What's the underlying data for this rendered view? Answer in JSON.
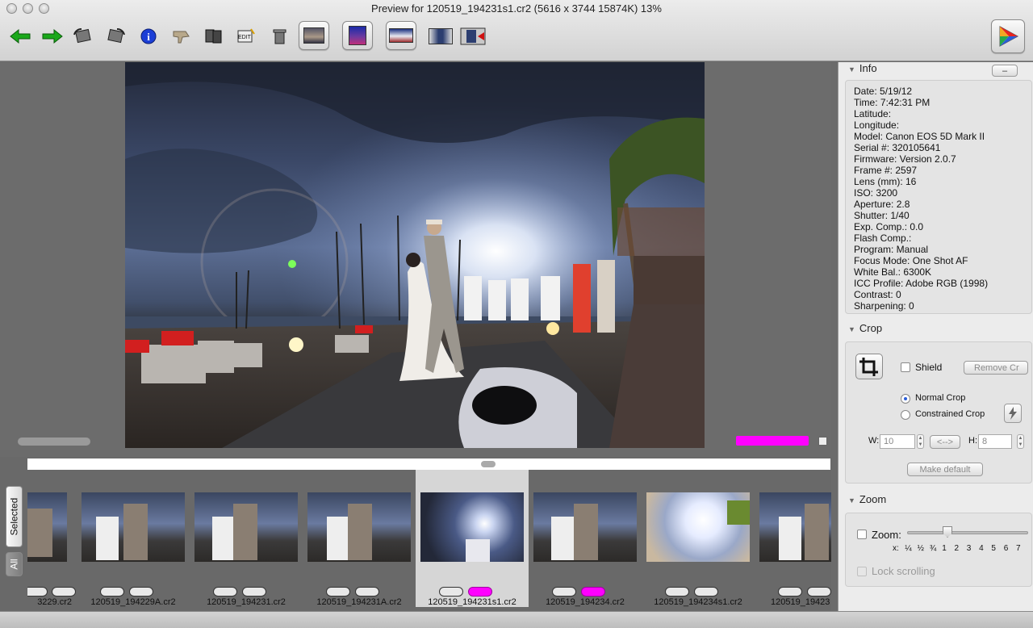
{
  "window": {
    "title": "Preview for 120519_194231s1.cr2 (5616 x 3744 15874K) 13%"
  },
  "toolbar": {
    "buttons": [
      {
        "name": "back-arrow-icon"
      },
      {
        "name": "forward-arrow-icon"
      },
      {
        "name": "rotate-left-icon"
      },
      {
        "name": "rotate-right-icon"
      },
      {
        "name": "info-icon"
      },
      {
        "name": "thumbs-down-icon"
      },
      {
        "name": "cards-icon"
      },
      {
        "name": "edit-text-icon"
      },
      {
        "name": "trash-icon"
      }
    ],
    "view_buttons": [
      {
        "name": "light-table-view-icon"
      },
      {
        "name": "preview-view-icon"
      },
      {
        "name": "filmstrip-view-icon"
      },
      {
        "name": "single-view-icon"
      },
      {
        "name": "send-view-icon"
      }
    ],
    "color_icon": "color-wheel-icon"
  },
  "filmstrip": {
    "tabs": {
      "selected": "Selected",
      "all": "All"
    },
    "items": [
      {
        "file": "3229.cr2",
        "rated": false,
        "selected": false
      },
      {
        "file": "120519_194229A.cr2",
        "rated": false,
        "selected": false
      },
      {
        "file": "120519_194231.cr2",
        "rated": false,
        "selected": false
      },
      {
        "file": "120519_194231A.cr2",
        "rated": false,
        "selected": false
      },
      {
        "file": "120519_194231s1.cr2",
        "rated": true,
        "selected": true
      },
      {
        "file": "120519_194234.cr2",
        "rated": true,
        "selected": false
      },
      {
        "file": "120519_194234s1.cr2",
        "rated": false,
        "selected": false
      },
      {
        "file": "120519_19423",
        "rated": false,
        "selected": false
      }
    ]
  },
  "inspector": {
    "info": {
      "title": "Info",
      "collapse_label": "–",
      "lines": [
        "Date: 5/19/12",
        "Time: 7:42:31 PM",
        "Latitude:",
        "Longitude:",
        "Model: Canon EOS 5D Mark II",
        "Serial #: 320105641",
        "Firmware: Version 2.0.7",
        "Frame #: 2597",
        "Lens (mm): 16",
        "ISO: 3200",
        "Aperture: 2.8",
        "Shutter: 1/40",
        "Exp. Comp.: 0.0",
        "Flash Comp.:",
        "Program: Manual",
        "Focus Mode: One Shot AF",
        "White Bal.: 6300K",
        "ICC Profile: Adobe RGB (1998)",
        "Contrast: 0",
        "Sharpening: 0"
      ]
    },
    "crop": {
      "title": "Crop",
      "shield_label": "Shield",
      "remove_crop_label": "Remove Cr",
      "normal_crop_label": "Normal Crop",
      "constrained_crop_label": "Constrained Crop",
      "w_label": "W:",
      "w_value": "10",
      "swap_label": "<-->",
      "h_label": "H:",
      "h_value": "8",
      "make_default_label": "Make default"
    },
    "zoom": {
      "title": "Zoom",
      "zoom_label": "Zoom:",
      "scale_labels": [
        "x:",
        "¼",
        "½",
        "¾",
        "1",
        "2",
        "3",
        "4",
        "5",
        "6",
        "7"
      ],
      "lock_label": "Lock scrolling"
    }
  },
  "colors": {
    "rating_pink": "#ff00ff",
    "selected_cell": "#d6d6d6"
  }
}
